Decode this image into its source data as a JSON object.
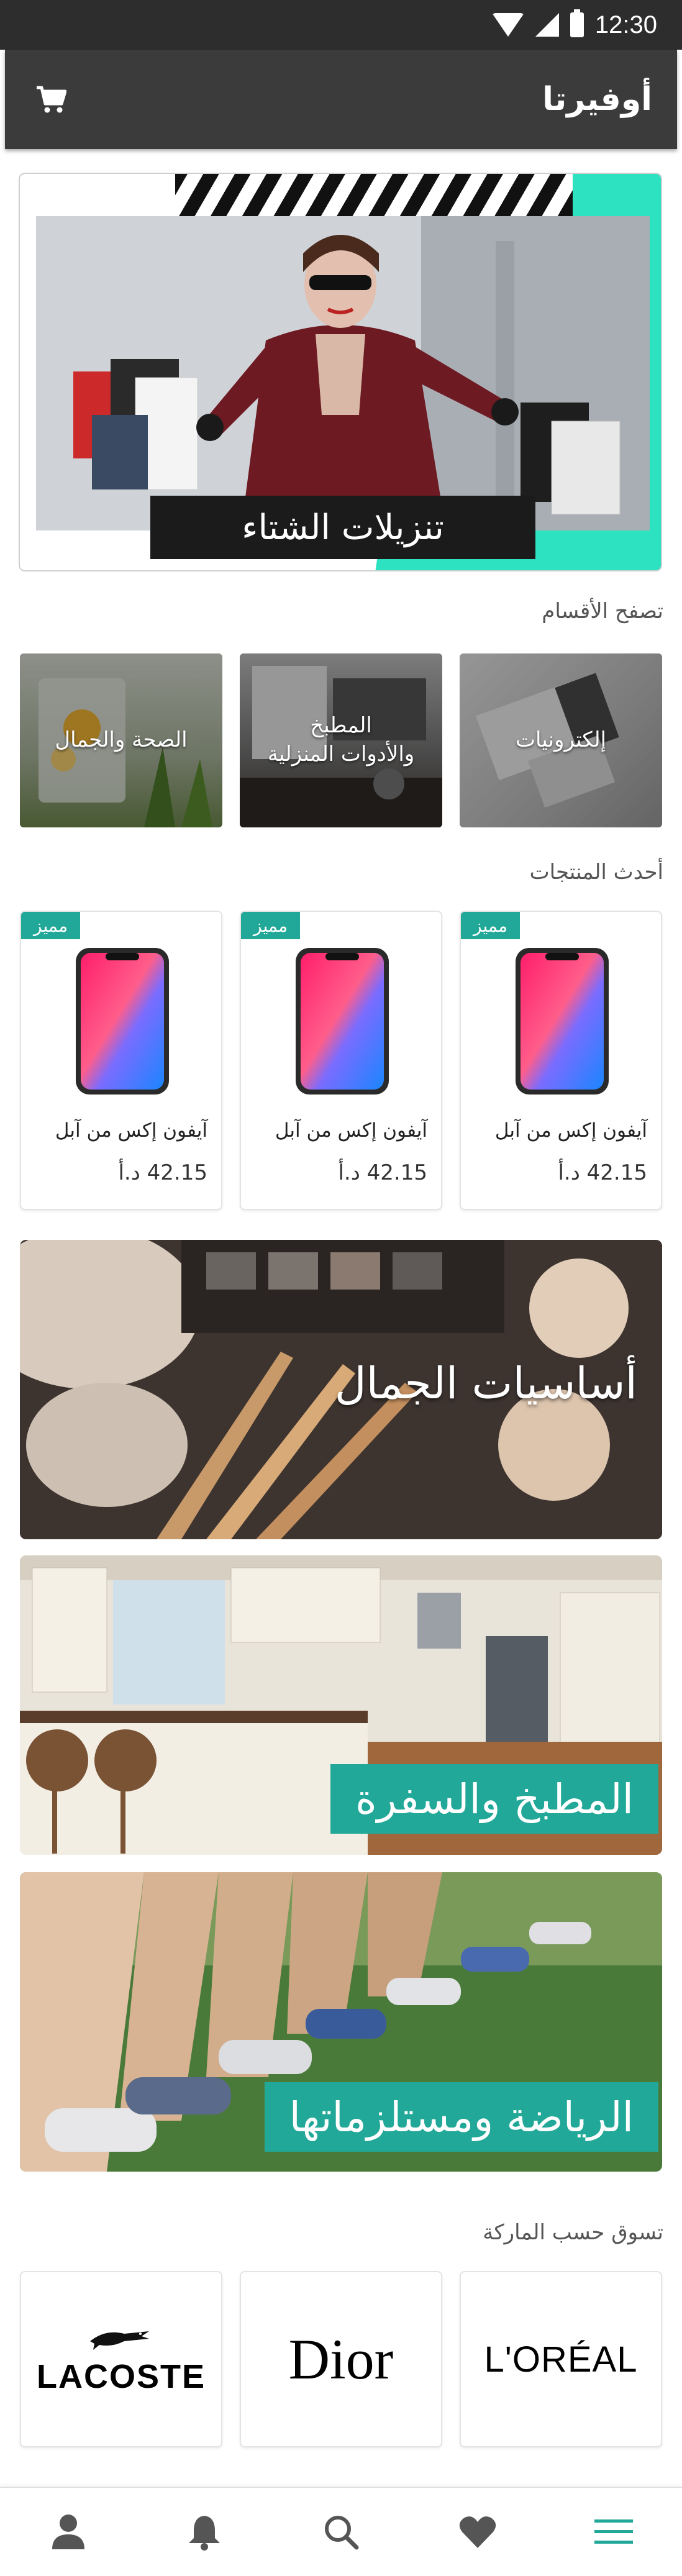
{
  "status_bar": {
    "time": "12:30"
  },
  "app_bar": {
    "title": "أوفيرتا",
    "cart_icon": "cart-icon"
  },
  "banner": {
    "caption": "تنزيلات الشتاء",
    "accent_color": "#2de2c0"
  },
  "categories": {
    "title": "تصفح الأقسام",
    "items": [
      {
        "label": "إلكترونيات"
      },
      {
        "label": "المطبخ\nوالأدوات المنزلية"
      },
      {
        "label": "الصحة والجمال"
      }
    ]
  },
  "latest_products": {
    "title": "أحدث المنتجات",
    "items": [
      {
        "badge": "مميز",
        "name": "آيفون إكس من آبل",
        "price": "42.15 د.أ"
      },
      {
        "badge": "مميز",
        "name": "آيفون إكس من آبل",
        "price": "42.15 د.أ"
      },
      {
        "badge": "مميز",
        "name": "آيفون إكس من آبل",
        "price": "42.15 د.أ"
      }
    ]
  },
  "promos": [
    {
      "title": "أساسيات الجمال"
    },
    {
      "title": "المطبخ والسفرة"
    },
    {
      "title": "الرياضة ومستلزماتها"
    }
  ],
  "brands": {
    "title": "تسوق حسب الماركة",
    "items": [
      {
        "name": "L'ORÉAL"
      },
      {
        "name": "Dior"
      },
      {
        "name": "LACOSTE"
      }
    ]
  },
  "bottom_nav": {
    "items": [
      "menu-icon",
      "heart-icon",
      "search-icon",
      "bell-icon",
      "user-icon"
    ]
  },
  "colors": {
    "accent": "#22a898",
    "appbar": "#3b3b3b"
  }
}
